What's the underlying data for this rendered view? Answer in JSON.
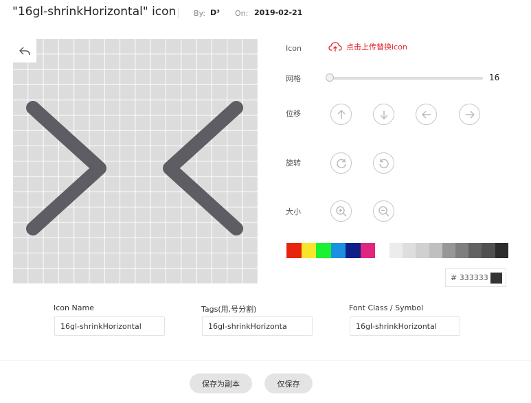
{
  "header": {
    "title": "\"16gl-shrinkHorizontal\"  icon",
    "by_label": "By:",
    "by_value": "D³",
    "on_label": "On:",
    "on_value": "2019-02-21"
  },
  "canvas": {
    "undo_icon": "undo-icon",
    "grid_cells": 16,
    "glyph_color": "#5e5d64"
  },
  "panel": {
    "icon_label": "Icon",
    "upload_text": "点击上传替换icon",
    "upload_icon": "cloud-upload-icon",
    "grid_label": "网格",
    "grid_value": "16",
    "grid_fraction": 0.0,
    "move_label": "位移",
    "rotate_label": "旋转",
    "size_label": "大小",
    "accent_color": "#e3252b"
  },
  "palette": {
    "colors": [
      "#e8240f",
      "#f5e62a",
      "#19f232",
      "#1a90e0",
      "#0f1f87",
      "#e0257e"
    ],
    "grays": [
      "#ececec",
      "#dedede",
      "#d0d0d0",
      "#bfbfbf",
      "#979797",
      "#7f7f7f",
      "#626262",
      "#505050",
      "#2c2c2c"
    ]
  },
  "hex": {
    "prefix": "#",
    "value": "333333",
    "preview": "#333333"
  },
  "fields": {
    "name_label": "Icon Name",
    "name_value": "16gl-shrinkHorizontal",
    "tags_label": "Tags(用,号分割)",
    "tags_value": "16gl-shrinkHorizonta",
    "font_label": "Font Class / Symbol",
    "font_value": "16gl-shrinkHorizontal"
  },
  "actions": {
    "save_copy": "保存为副本",
    "save_only": "仅保存"
  }
}
